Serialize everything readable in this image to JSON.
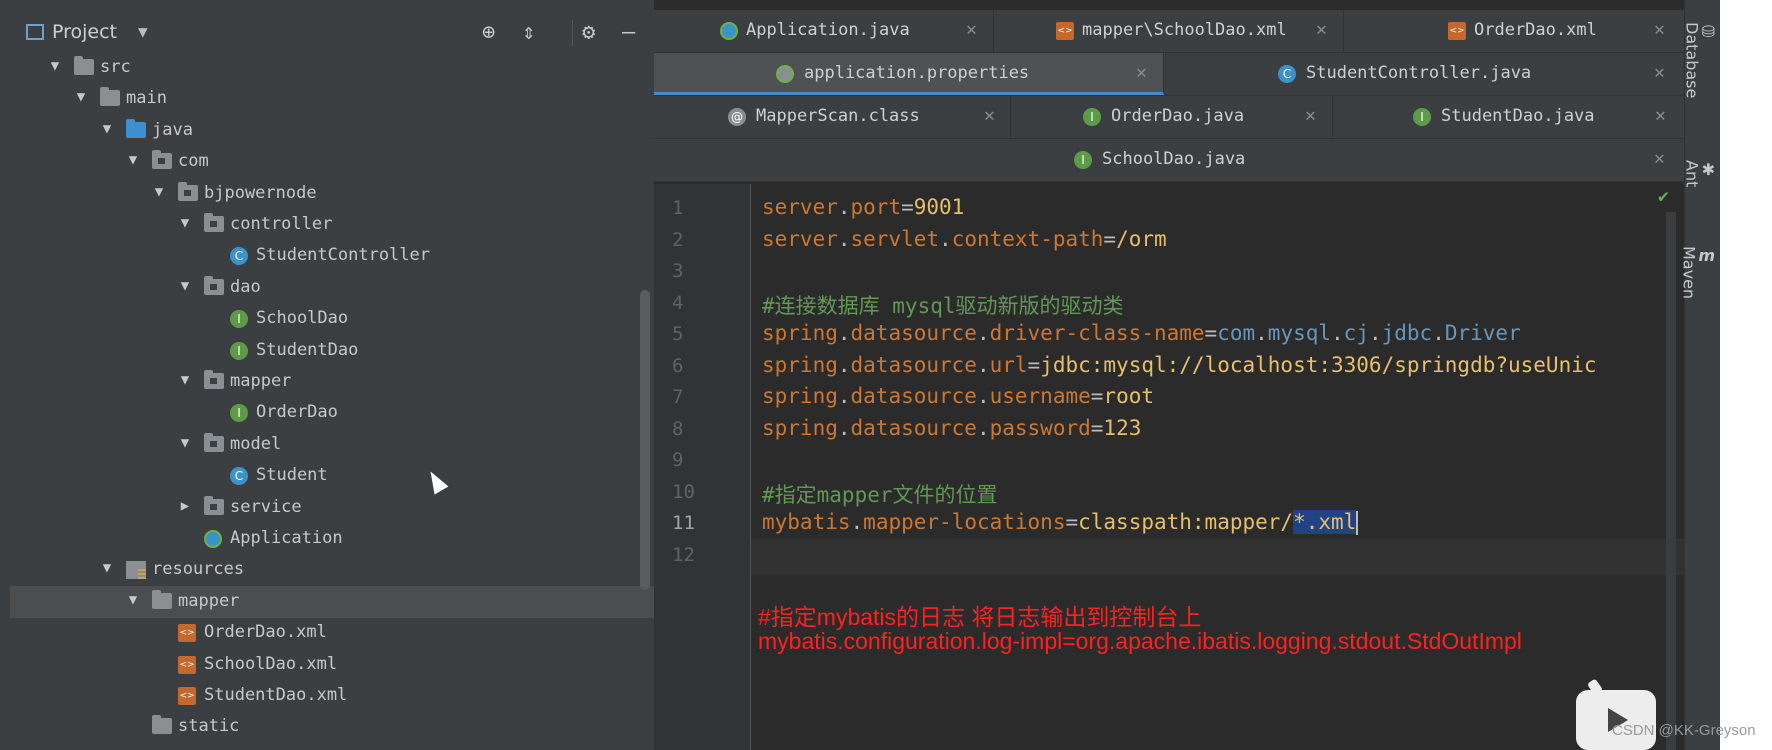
{
  "project_panel": {
    "title": "Project",
    "tree": [
      {
        "label": "src",
        "type": "folder",
        "depth": 0,
        "expanded": true
      },
      {
        "label": "main",
        "type": "folder",
        "depth": 1,
        "expanded": true
      },
      {
        "label": "java",
        "type": "folder-blue",
        "depth": 2,
        "expanded": true
      },
      {
        "label": "com",
        "type": "package",
        "depth": 3,
        "expanded": true
      },
      {
        "label": "bjpowernode",
        "type": "package",
        "depth": 4,
        "expanded": true
      },
      {
        "label": "controller",
        "type": "package",
        "depth": 5,
        "expanded": true
      },
      {
        "label": "StudentController",
        "type": "class",
        "depth": 6
      },
      {
        "label": "dao",
        "type": "package",
        "depth": 5,
        "expanded": true
      },
      {
        "label": "SchoolDao",
        "type": "interface",
        "depth": 6
      },
      {
        "label": "StudentDao",
        "type": "interface",
        "depth": 6
      },
      {
        "label": "mapper",
        "type": "package",
        "depth": 5,
        "expanded": true
      },
      {
        "label": "OrderDao",
        "type": "interface",
        "depth": 6
      },
      {
        "label": "model",
        "type": "package",
        "depth": 5,
        "expanded": true
      },
      {
        "label": "Student",
        "type": "class",
        "depth": 6
      },
      {
        "label": "service",
        "type": "package",
        "depth": 5,
        "expanded": false
      },
      {
        "label": "Application",
        "type": "spring",
        "depth": 5
      },
      {
        "label": "resources",
        "type": "resources",
        "depth": 2,
        "expanded": true
      },
      {
        "label": "mapper",
        "type": "folder",
        "depth": 3,
        "expanded": true,
        "selected": true
      },
      {
        "label": "OrderDao.xml",
        "type": "xml",
        "depth": 4
      },
      {
        "label": "SchoolDao.xml",
        "type": "xml",
        "depth": 4
      },
      {
        "label": "StudentDao.xml",
        "type": "xml",
        "depth": 4
      },
      {
        "label": "static",
        "type": "folder",
        "depth": 3
      }
    ]
  },
  "tabs": {
    "row1": [
      {
        "label": "Application.java",
        "icon": "spring-icon"
      },
      {
        "label": "mapper\\SchoolDao.xml",
        "icon": "xml-icon"
      },
      {
        "label": "OrderDao.xml",
        "icon": "xml-icon"
      }
    ],
    "row2": [
      {
        "label": "application.properties",
        "icon": "properties-icon",
        "active": true
      },
      {
        "label": "StudentController.java",
        "icon": "class-icon"
      }
    ],
    "row3": [
      {
        "label": "MapperScan.class",
        "icon": "annotation-icon"
      },
      {
        "label": "OrderDao.java",
        "icon": "interface-icon"
      },
      {
        "label": "StudentDao.java",
        "icon": "interface-icon"
      }
    ],
    "row4": [
      {
        "label": "SchoolDao.java",
        "icon": "interface-icon"
      }
    ]
  },
  "editor": {
    "current_line": 11,
    "lines": [
      {
        "n": "1",
        "key": "server.port",
        "eq": "=",
        "val": "9001"
      },
      {
        "n": "2",
        "key": "server.servlet.context-path",
        "eq": "=",
        "val": "/orm"
      },
      {
        "n": "3"
      },
      {
        "n": "4",
        "comment": "#连接数据库 mysql驱动新版的驱动类"
      },
      {
        "n": "5",
        "key": "spring.datasource.driver-class-name",
        "eq": "=",
        "val": "com.mysql.cj.jdbc.Driver"
      },
      {
        "n": "6",
        "key": "spring.datasource.url",
        "eq": "=",
        "val": "jdbc:mysql://localhost:3306/springdb?useUnic"
      },
      {
        "n": "7",
        "key": "spring.datasource.username",
        "eq": "=",
        "val": "root"
      },
      {
        "n": "8",
        "key": "spring.datasource.password",
        "eq": "=",
        "val": "123"
      },
      {
        "n": "9"
      },
      {
        "n": "10",
        "comment": "#指定mapper文件的位置"
      },
      {
        "n": "11",
        "key": "mybatis.mapper-locations",
        "eq": "=",
        "val": "classpath:mapper/",
        "selected": "*.xml"
      },
      {
        "n": "12"
      }
    ]
  },
  "annotations": [
    "#指定mybatis的日志 将日志输出到控制台上",
    "mybatis.configuration.log-impl=org.apache.ibatis.logging.stdout.StdOutImpl"
  ],
  "right_tools": [
    "Database",
    "Ant",
    "Maven"
  ],
  "watermark": "CSDN @KK-Greyson",
  "colors": {
    "key": "#cc7832",
    "value": "#e8bf6a",
    "class_ref": "#6897bb",
    "comment": "#629755",
    "annotation": "#ff2020"
  }
}
